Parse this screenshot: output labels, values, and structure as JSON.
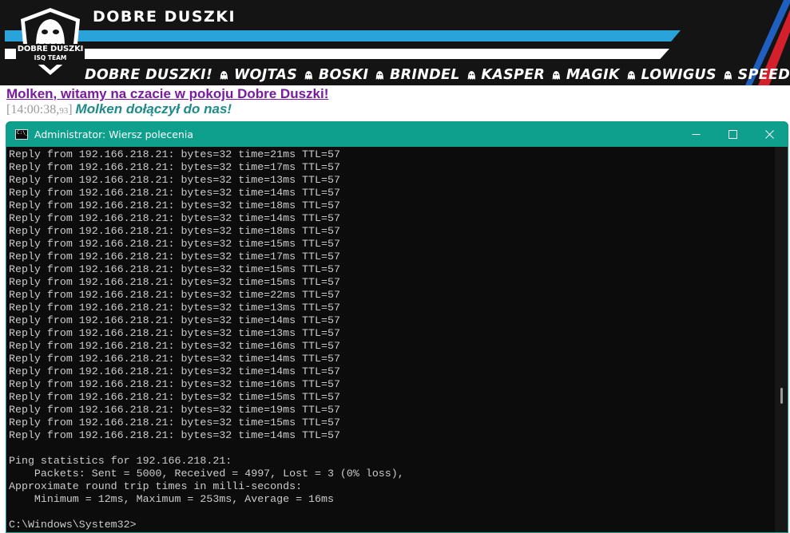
{
  "banner": {
    "site_title": "DOBRE DUSZKI",
    "logo_text_1": "DOBRE DUSZKI",
    "logo_text_2": "ISQ TEAM",
    "nav": [
      "DOBRE DUSZKI!",
      "WOJTAS",
      "BOSKI",
      "BRINDEL",
      "KASPER",
      "MAGIK",
      "LOWIGUS",
      "SPEED"
    ],
    "colors": {
      "background": "#141414",
      "stripe_blue": "#2aa3db",
      "accent_red": "#d4202a"
    }
  },
  "chat": {
    "welcome": "Molken, witamy na czacie w pokoju Dobre Duszki!",
    "timestamp": "[14:00:38,",
    "timestamp_ms": "93",
    "timestamp_close": "]",
    "join_message": "Molken dołączył do nas!"
  },
  "window": {
    "title": "Administrator: Wiersz polecenia",
    "icon": "cmd-icon",
    "buttons": [
      "minimize-icon",
      "maximize-icon",
      "close-icon"
    ],
    "titlebar_color": "#0e9f8d"
  },
  "console": {
    "lines": [
      "Reply from 192.166.218.21: bytes=32 time=21ms TTL=57",
      "Reply from 192.166.218.21: bytes=32 time=17ms TTL=57",
      "Reply from 192.166.218.21: bytes=32 time=13ms TTL=57",
      "Reply from 192.166.218.21: bytes=32 time=14ms TTL=57",
      "Reply from 192.166.218.21: bytes=32 time=18ms TTL=57",
      "Reply from 192.166.218.21: bytes=32 time=14ms TTL=57",
      "Reply from 192.166.218.21: bytes=32 time=18ms TTL=57",
      "Reply from 192.166.218.21: bytes=32 time=15ms TTL=57",
      "Reply from 192.166.218.21: bytes=32 time=17ms TTL=57",
      "Reply from 192.166.218.21: bytes=32 time=15ms TTL=57",
      "Reply from 192.166.218.21: bytes=32 time=15ms TTL=57",
      "Reply from 192.166.218.21: bytes=32 time=22ms TTL=57",
      "Reply from 192.166.218.21: bytes=32 time=13ms TTL=57",
      "Reply from 192.166.218.21: bytes=32 time=14ms TTL=57",
      "Reply from 192.166.218.21: bytes=32 time=13ms TTL=57",
      "Reply from 192.166.218.21: bytes=32 time=16ms TTL=57",
      "Reply from 192.166.218.21: bytes=32 time=14ms TTL=57",
      "Reply from 192.166.218.21: bytes=32 time=14ms TTL=57",
      "Reply from 192.166.218.21: bytes=32 time=16ms TTL=57",
      "Reply from 192.166.218.21: bytes=32 time=15ms TTL=57",
      "Reply from 192.166.218.21: bytes=32 time=19ms TTL=57",
      "Reply from 192.166.218.21: bytes=32 time=15ms TTL=57",
      "Reply from 192.166.218.21: bytes=32 time=14ms TTL=57",
      "",
      "Ping statistics for 192.166.218.21:",
      "    Packets: Sent = 5000, Received = 4997, Lost = 3 (0% loss),",
      "Approximate round trip times in milli-seconds:",
      "    Minimum = 12ms, Maximum = 253ms, Average = 16ms",
      "",
      "C:\\Windows\\System32>"
    ]
  }
}
